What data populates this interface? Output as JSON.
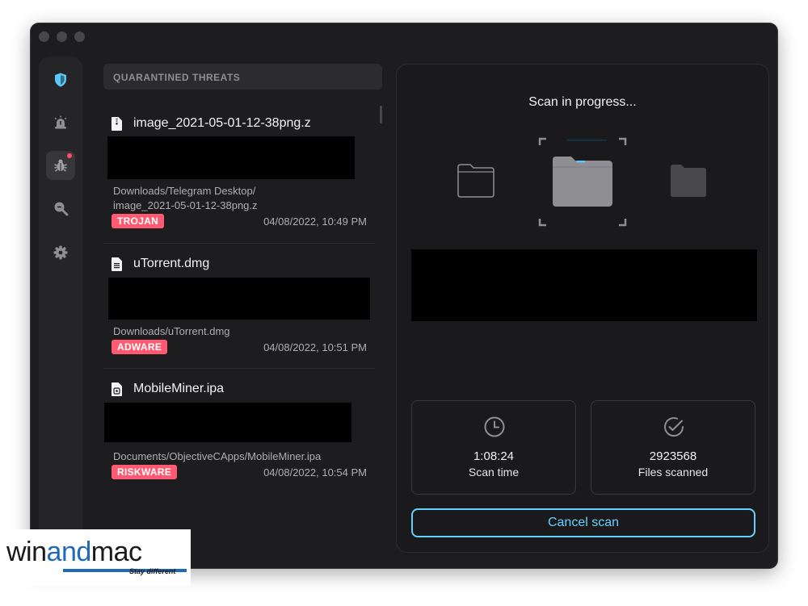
{
  "list_header": "QUARANTINED THREATS",
  "threats": [
    {
      "name": "image_2021-05-01-12-38png.z",
      "path": "Downloads/Telegram Desktop/\nimage_2021-05-01-12-38png.z",
      "badge": "TROJAN",
      "date": "04/08/2022, 10:49 PM",
      "file_icon": "zip-file-icon"
    },
    {
      "name": "uTorrent.dmg",
      "path": "Downloads/uTorrent.dmg",
      "badge": "ADWARE",
      "date": "04/08/2022, 10:51 PM",
      "file_icon": "disk-image-file-icon"
    },
    {
      "name": "MobileMiner.ipa",
      "path": "Documents/ObjectiveCApps/MobileMiner.ipa",
      "badge": "RISKWARE",
      "date": "04/08/2022, 10:54 PM",
      "file_icon": "app-file-icon"
    }
  ],
  "scan": {
    "title": "Scan in progress...",
    "time_value": "1:08:24",
    "time_label": "Scan time",
    "files_value": "2923568",
    "files_label": "Files scanned",
    "cancel_label": "Cancel scan"
  },
  "sidebar": {
    "items": [
      "shield-icon",
      "alarm-icon",
      "bug-icon",
      "search-icon",
      "gear-icon"
    ],
    "active": "bug-icon"
  },
  "watermark": {
    "part1": "win",
    "part2": "and",
    "part3": "mac",
    "tagline": "Stay different"
  },
  "colors": {
    "badge": "#ff5a72",
    "accent": "#64d2ff",
    "shield": "#5ac8fa"
  }
}
